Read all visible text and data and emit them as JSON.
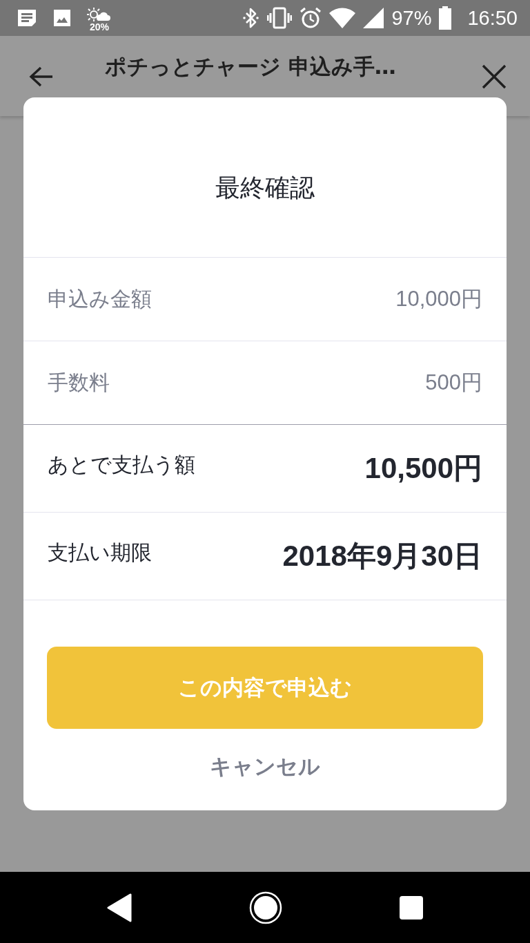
{
  "status_bar": {
    "weather_text": "20%",
    "battery_text": "97%",
    "time": "16:50"
  },
  "app_bar": {
    "title": "ポチっとチャージ 申込み手…"
  },
  "dialog": {
    "title": "最終確認",
    "rows": [
      {
        "kind": "detail",
        "label": "申込み金額",
        "value": "10,000円"
      },
      {
        "kind": "detail",
        "label": "手数料",
        "value": "500円"
      },
      {
        "kind": "total",
        "label": "あとで支払う額",
        "value": "10,500円"
      },
      {
        "kind": "total",
        "label": "支払い期限",
        "value": "2018年9月30日"
      }
    ],
    "primary_button": "この内容で申込む",
    "cancel_button": "キャンセル"
  }
}
